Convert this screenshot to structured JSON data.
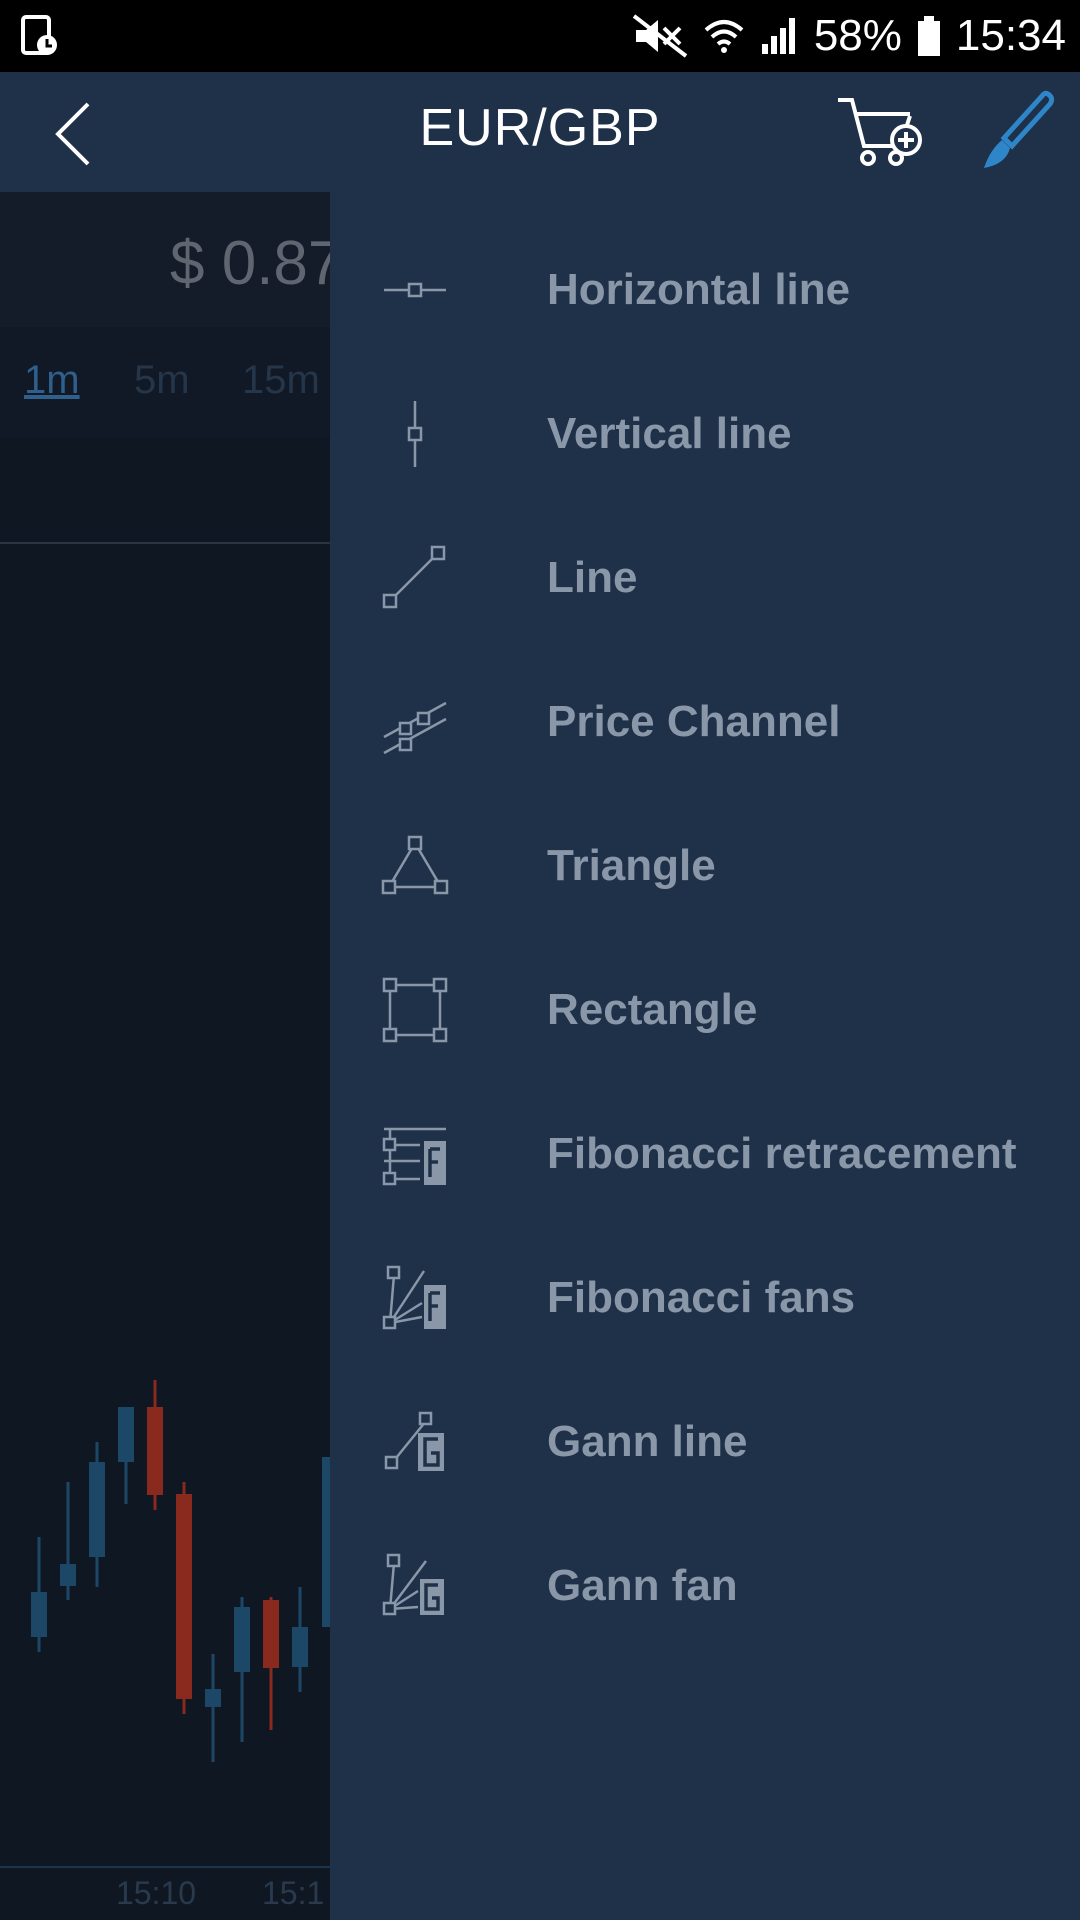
{
  "status_bar": {
    "battery": "58%",
    "time": "15:34",
    "icons": [
      "alarm-phone-icon",
      "mute-icon",
      "wifi-icon",
      "signal-icon",
      "battery-icon"
    ]
  },
  "app_bar": {
    "title": "EUR/GBP",
    "icons": [
      "back-icon",
      "cart-add-icon",
      "brush-icon"
    ],
    "accent_color": "#2e86c8"
  },
  "chart_background": {
    "price": "$ 0.87",
    "timeframes": [
      "1m",
      "5m",
      "15m"
    ],
    "active_timeframe": "1m",
    "x_labels": [
      "15:10",
      "15:1"
    ]
  },
  "drawing_tools": [
    {
      "label": "Horizontal line",
      "icon": "horizontal-line-icon"
    },
    {
      "label": "Vertical line",
      "icon": "vertical-line-icon"
    },
    {
      "label": "Line",
      "icon": "line-icon"
    },
    {
      "label": "Price Channel",
      "icon": "price-channel-icon"
    },
    {
      "label": "Triangle",
      "icon": "triangle-icon"
    },
    {
      "label": "Rectangle",
      "icon": "rectangle-icon"
    },
    {
      "label": "Fibonacci retracement",
      "icon": "fibonacci-retracement-icon"
    },
    {
      "label": "Fibonacci fans",
      "icon": "fibonacci-fans-icon"
    },
    {
      "label": "Gann line",
      "icon": "gann-line-icon"
    },
    {
      "label": "Gann fan",
      "icon": "gann-fan-icon"
    }
  ],
  "colors": {
    "drawer_bg": "#1f3049",
    "tool_text": "#8a97a8",
    "bull_candle": "#1c4766",
    "bear_candle": "#8a2a1f"
  }
}
